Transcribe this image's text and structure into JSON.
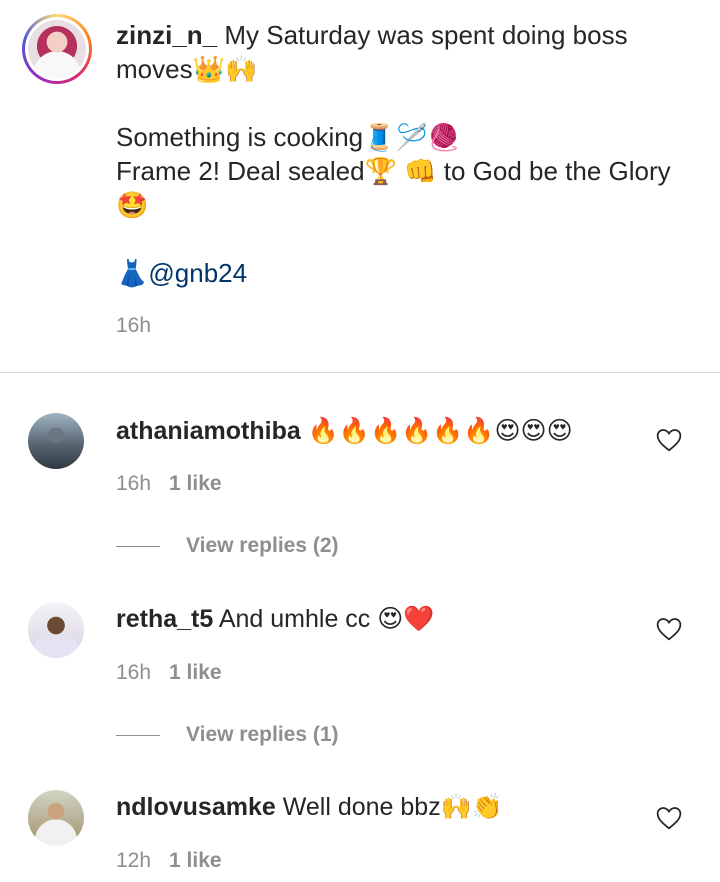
{
  "caption": {
    "username": "zinzi_n_",
    "line1": "My Saturday was spent doing boss",
    "line2": "moves👑🙌",
    "line3": "Something is cooking🧵🪡🧶",
    "line4": "Frame 2! Deal sealed🏆 👊 to God be the Glory",
    "line5": "🤩",
    "line6_emoji": "👗",
    "line6_mention": "@gnb24",
    "time": "16h"
  },
  "comments": [
    {
      "username": "athaniamothiba",
      "text": "🔥🔥🔥🔥🔥🔥😍😍😍",
      "time": "16h",
      "likes": "1 like",
      "replies": "View replies (2)"
    },
    {
      "username": "retha_t5",
      "text": "And umhle cc 😍❤️",
      "time": "16h",
      "likes": "1 like",
      "replies": "View replies (1)"
    },
    {
      "username": "ndlovusamke",
      "text": "Well done bbz🙌👏",
      "time": "12h",
      "likes": "1 like"
    }
  ]
}
